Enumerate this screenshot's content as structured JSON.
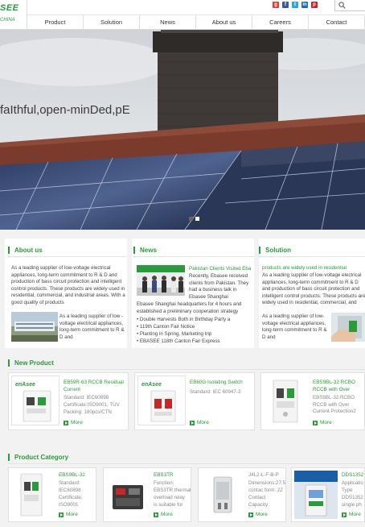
{
  "header": {
    "logo_main": "SEE",
    "logo_sub": "CHINA",
    "social_icons": [
      "google-plus-icon",
      "facebook-icon",
      "twitter-icon",
      "linkedin-icon",
      "pinterest-icon"
    ],
    "nav": [
      "Product",
      "Solution",
      "News",
      "About us",
      "Careers",
      "Contact"
    ]
  },
  "banner": {
    "slogan": "faIthful,open-minDed,pE",
    "slides": 2,
    "active_slide": 2
  },
  "about": {
    "title": "About us",
    "intro": "As a leading supplier of low-voltage electrical appliances, long-term commitment to R & D and production of bass circuit protection and intelligent control products. These products are widely used in residential, commercial, and industrial areas. With a good quality of products",
    "side_text": "As a leading supplier of low -voltage electrical appliances, long-term commitment to R & D and"
  },
  "news": {
    "title": "News",
    "headline": "Pakistan Clients Visited Eba",
    "summary": "Recently, Ebasee received clients from Pakistan. They had a business talk in Ebasee Shanghai headquarters for 4 hours and established a preliminary cooperation strategy",
    "items": [
      "• Double Harvests Both in Birthday Party a",
      "• 119th Canton Fair Notice",
      "• Planting in Spring, Marketing trip",
      "• EBASEE 118th Canton Fair Express"
    ]
  },
  "solution": {
    "title": "Solution",
    "headline": "products are widely used in residential",
    "intro": "As a leading supplier of low-voltage electrical appliances, long-term commitment to R & D and production of bass circuit protection and intelligent control products. These products are widely used in residential, commercial, and",
    "side_text": "As a leading supplier of low-voltage electrical appliances, long-term commitment to R & D and"
  },
  "new_product": {
    "title": "New Product",
    "cards": [
      {
        "brand": "enAsee",
        "title": "EB59R-63 RCCB Residual Current",
        "lines": [
          "Standard: IEC60898",
          "Certificate:ISO9001, TUV",
          "Packing: 180pcs/CTN"
        ],
        "more": "More"
      },
      {
        "brand": "enAsee",
        "title": "EB60G Isolating Switch",
        "lines": [
          "Standard: IEC 60947-3"
        ],
        "more": "More"
      },
      {
        "brand": "",
        "title": "EBS9BL-32 RCBO RCCB with Over",
        "lines": [
          "EBS9BL-32 RCBO RCCB with Over Current Protection2"
        ],
        "more": "More"
      }
    ]
  },
  "product_category": {
    "title": "Product Category",
    "cards": [
      {
        "title": "EBS9BL-32",
        "lines": [
          "Standard:",
          "IEC60898",
          "Certificate:",
          "ISO9001"
        ],
        "more": "More"
      },
      {
        "title": "EBS3TR",
        "lines": [
          "Function:",
          "EBS3TR thermal",
          "overload relay",
          "is suitable for"
        ],
        "more": "More"
      },
      {
        "title": "J4L2-L-F-B-P",
        "lines": [
          "Dimensions:27.5",
          "contac form: 2Z",
          "Contact",
          "Capacity:"
        ],
        "more": "More"
      },
      {
        "title": "DDS1352",
        "lines": [
          "Applicatio",
          "Type",
          "DDS1352",
          "single ph"
        ],
        "more": "More"
      }
    ]
  },
  "colors": {
    "accent_green": "#2a9a3a",
    "page_bg": "#f2f2f2"
  }
}
